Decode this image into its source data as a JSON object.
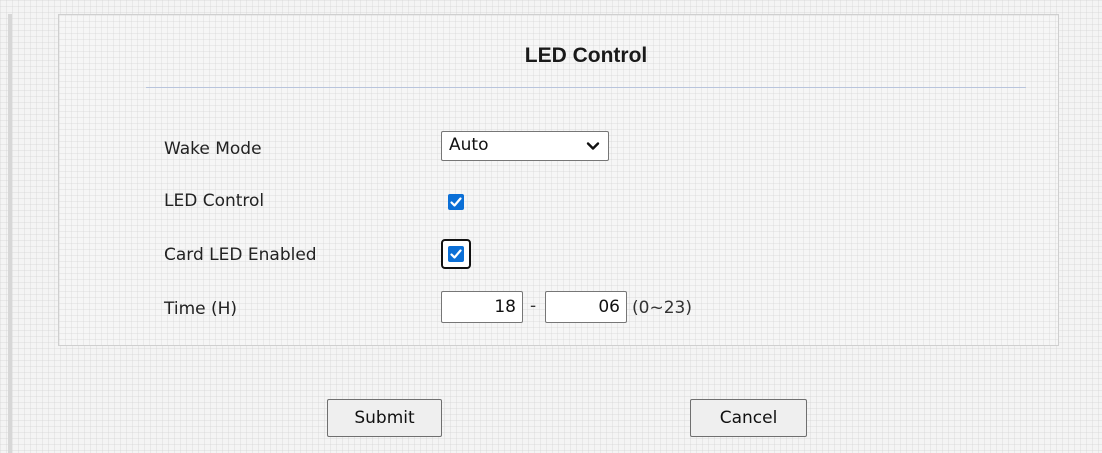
{
  "panel": {
    "title": "LED Control"
  },
  "form": {
    "wake_mode": {
      "label": "Wake Mode",
      "selected": "Auto"
    },
    "led_control": {
      "label": "LED Control",
      "checked": true
    },
    "card_led_enabled": {
      "label": "Card LED Enabled",
      "checked": true
    },
    "time": {
      "label": "Time (H)",
      "start_value": "18",
      "separator": "-",
      "end_value": "06",
      "range_hint": "(0~23)"
    }
  },
  "actions": {
    "submit_label": "Submit",
    "cancel_label": "Cancel"
  },
  "colors": {
    "checkbox_accent": "#0b6fd6",
    "divider": "#b8c4dc"
  },
  "icons": {
    "select_chevron": "chevron-down-icon",
    "checkmark": "checkmark-icon"
  }
}
